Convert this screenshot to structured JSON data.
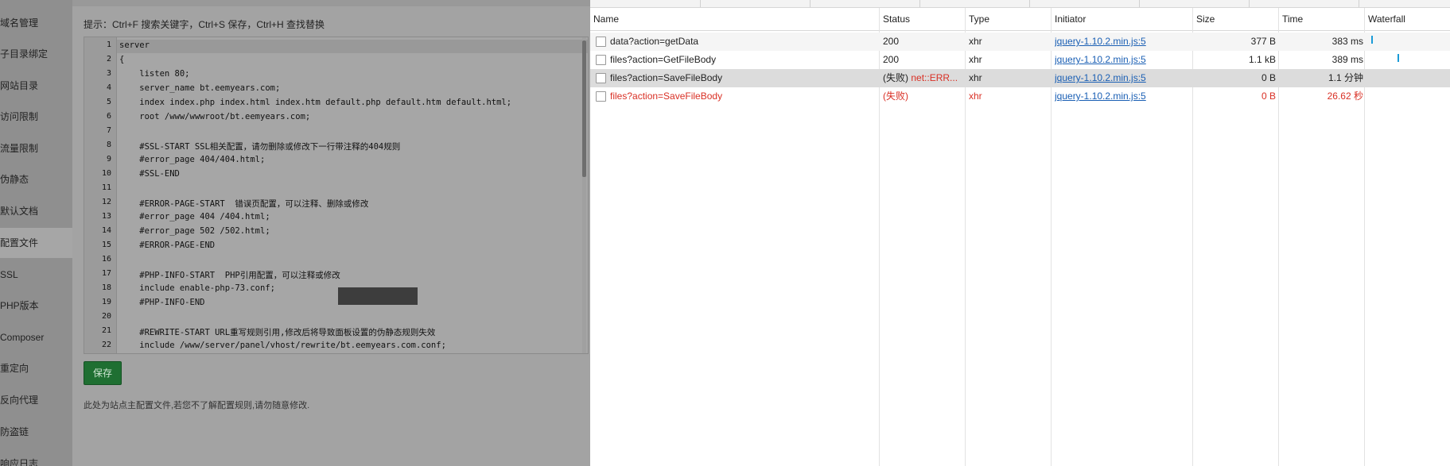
{
  "sidebar": {
    "items": [
      {
        "label": "域名管理",
        "active": false
      },
      {
        "label": "子目录绑定",
        "active": false
      },
      {
        "label": "网站目录",
        "active": false
      },
      {
        "label": "访问限制",
        "active": false
      },
      {
        "label": "流量限制",
        "active": false
      },
      {
        "label": "伪静态",
        "active": false
      },
      {
        "label": "默认文档",
        "active": false
      },
      {
        "label": "配置文件",
        "active": true
      },
      {
        "label": "SSL",
        "active": false
      },
      {
        "label": "PHP版本",
        "active": false
      },
      {
        "label": "Composer",
        "active": false
      },
      {
        "label": "重定向",
        "active": false
      },
      {
        "label": "反向代理",
        "active": false
      },
      {
        "label": "防盗链",
        "active": false
      },
      {
        "label": "响应日志",
        "active": false
      }
    ]
  },
  "editor": {
    "tip": "提示：Ctrl+F 搜索关键字，Ctrl+S 保存，Ctrl+H 查找替换",
    "lines": [
      {
        "n": "1",
        "text": "server",
        "cls": "kw"
      },
      {
        "n": "2",
        "text": "{",
        "cls": ""
      },
      {
        "n": "3",
        "text": "    listen 80;",
        "cls": ""
      },
      {
        "n": "4",
        "text": "    server_name bt.eemyears.com;",
        "cls": "kw"
      },
      {
        "n": "5",
        "text": "    index index.php index.html index.htm default.php default.htm default.html;",
        "cls": "kw"
      },
      {
        "n": "6",
        "text": "    root /www/wwwroot/bt.eemyears.com;",
        "cls": "kw"
      },
      {
        "n": "7",
        "text": "",
        "cls": ""
      },
      {
        "n": "8",
        "text": "    #SSL-START SSL相关配置，请勿删除或修改下一行带注释的404规则",
        "cls": "cm"
      },
      {
        "n": "9",
        "text": "    #error_page 404/404.html;",
        "cls": "cm"
      },
      {
        "n": "10",
        "text": "    #SSL-END",
        "cls": "cm"
      },
      {
        "n": "11",
        "text": "",
        "cls": ""
      },
      {
        "n": "12",
        "text": "    #ERROR-PAGE-START  错误页配置，可以注释、删除或修改",
        "cls": "cm"
      },
      {
        "n": "13",
        "text": "    #error_page 404 /404.html;",
        "cls": "cm"
      },
      {
        "n": "14",
        "text": "    #error_page 502 /502.html;",
        "cls": "cm"
      },
      {
        "n": "15",
        "text": "    #ERROR-PAGE-END",
        "cls": "cm"
      },
      {
        "n": "16",
        "text": "",
        "cls": ""
      },
      {
        "n": "17",
        "text": "    #PHP-INFO-START  PHP引用配置，可以注释或修改",
        "cls": "cm"
      },
      {
        "n": "18",
        "text": "    include enable-php-73.conf;",
        "cls": "kw"
      },
      {
        "n": "19",
        "text": "    #PHP-INFO-END",
        "cls": "cm"
      },
      {
        "n": "20",
        "text": "",
        "cls": ""
      },
      {
        "n": "21",
        "text": "    #REWRITE-START URL重写规则引用,修改后将导致面板设置的伪静态规则失效",
        "cls": "cm"
      },
      {
        "n": "22",
        "text": "    include /www/server/panel/vhost/rewrite/bt.eemyears.com.conf;",
        "cls": "kw"
      }
    ],
    "save_label": "保存",
    "note": "此处为站点主配置文件,若您不了解配置规则,请勿随意修改."
  },
  "network": {
    "columns": [
      "Name",
      "Status",
      "Type",
      "Initiator",
      "Size",
      "Time",
      "Waterfall"
    ],
    "rows": [
      {
        "name": "data?action=getData",
        "status": "200",
        "status_detail": "",
        "type": "xhr",
        "initiator": "jquery-1.10.2.min.js:5",
        "size": "377 B",
        "time": "383 ms",
        "error": false,
        "selected": false
      },
      {
        "name": "files?action=GetFileBody",
        "status": "200",
        "status_detail": "",
        "type": "xhr",
        "initiator": "jquery-1.10.2.min.js:5",
        "size": "1.1 kB",
        "time": "389 ms",
        "error": false,
        "selected": false
      },
      {
        "name": "files?action=SaveFileBody",
        "status": "(失败)",
        "status_detail": "net::ERR...",
        "type": "xhr",
        "initiator": "jquery-1.10.2.min.js:5",
        "size": "0 B",
        "time": "1.1 分钟",
        "error": false,
        "selected": true
      },
      {
        "name": "files?action=SaveFileBody",
        "status": "(失败)",
        "status_detail": "",
        "type": "xhr",
        "initiator": "jquery-1.10.2.min.js:5",
        "size": "0 B",
        "time": "26.62 秒",
        "error": true,
        "selected": false
      }
    ]
  }
}
